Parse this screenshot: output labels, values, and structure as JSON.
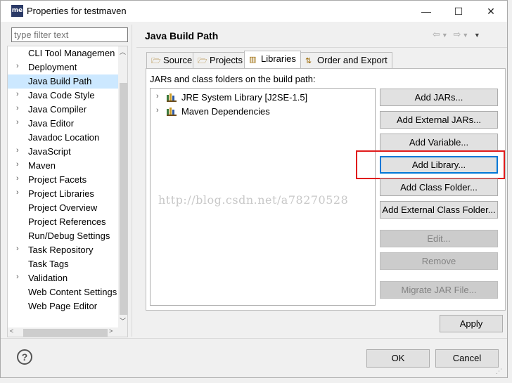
{
  "window": {
    "title": "Properties for testmaven",
    "app_icon_text": "me",
    "controls": {
      "minimize": "—",
      "maximize": "☐",
      "close": "✕"
    }
  },
  "filter": {
    "placeholder": "type filter text"
  },
  "tree": {
    "items": [
      {
        "label": "CLI Tool Managemen",
        "expandable": false
      },
      {
        "label": "Deployment",
        "expandable": true
      },
      {
        "label": "Java Build Path",
        "expandable": false,
        "selected": true
      },
      {
        "label": "Java Code Style",
        "expandable": true
      },
      {
        "label": "Java Compiler",
        "expandable": true
      },
      {
        "label": "Java Editor",
        "expandable": true
      },
      {
        "label": "Javadoc Location",
        "expandable": false
      },
      {
        "label": "JavaScript",
        "expandable": true
      },
      {
        "label": "Maven",
        "expandable": true
      },
      {
        "label": "Project Facets",
        "expandable": true
      },
      {
        "label": "Project Libraries",
        "expandable": true
      },
      {
        "label": "Project Overview",
        "expandable": false
      },
      {
        "label": "Project References",
        "expandable": false
      },
      {
        "label": "Run/Debug Settings",
        "expandable": false
      },
      {
        "label": "Task Repository",
        "expandable": true
      },
      {
        "label": "Task Tags",
        "expandable": false
      },
      {
        "label": "Validation",
        "expandable": true
      },
      {
        "label": "Web Content Settings",
        "expandable": false
      },
      {
        "label": "Web Page Editor",
        "expandable": false
      }
    ]
  },
  "page": {
    "title": "Java Build Path",
    "tabs": [
      {
        "label": "Source",
        "icon": "source-folder-icon",
        "active": false
      },
      {
        "label": "Projects",
        "icon": "projects-icon",
        "active": false
      },
      {
        "label": "Libraries",
        "icon": "libraries-icon",
        "active": true
      },
      {
        "label": "Order and Export",
        "icon": "order-export-icon",
        "active": false
      }
    ],
    "section_label": "JARs and class folders on the build path:",
    "libraries": [
      {
        "label": "JRE System Library [J2SE-1.5]"
      },
      {
        "label": "Maven Dependencies"
      }
    ],
    "buttons": {
      "add_jars": "Add JARs...",
      "add_external_jars": "Add External JARs...",
      "add_variable": "Add Variable...",
      "add_library": "Add Library...",
      "add_class_folder": "Add Class Folder...",
      "add_external_class_folder": "Add External Class Folder...",
      "edit": "Edit...",
      "remove": "Remove",
      "migrate_jar": "Migrate JAR File..."
    },
    "watermark": "http://blog.csdn.net/a78270528"
  },
  "footer": {
    "apply": "Apply",
    "ok": "OK",
    "cancel": "Cancel",
    "help": "?"
  },
  "colors": {
    "highlight_box": "#e01b1b",
    "selection": "#cce8ff",
    "focus_border": "#0078d7"
  }
}
